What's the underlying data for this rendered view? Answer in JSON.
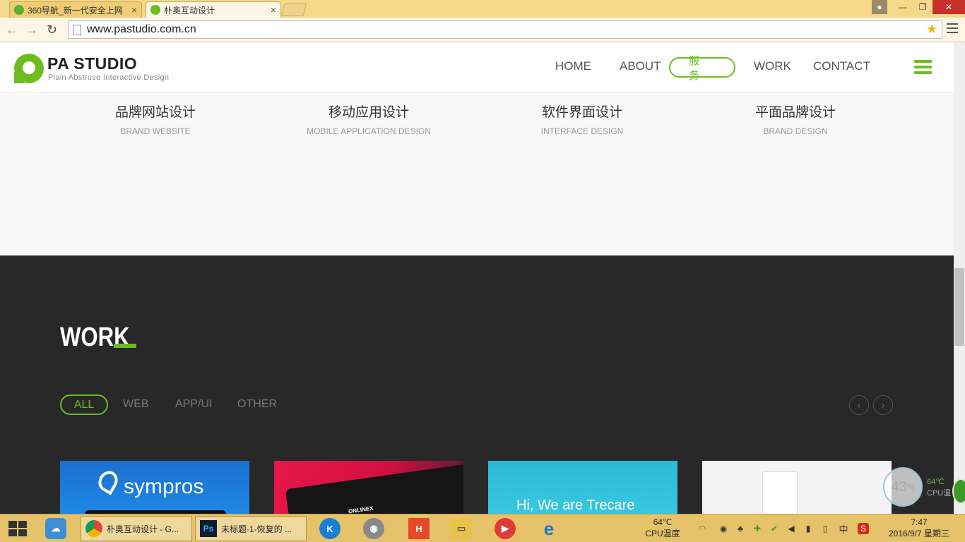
{
  "browser": {
    "tabs": [
      {
        "title": "360导航_新一代安全上网",
        "close": "×"
      },
      {
        "title": "朴奥互动设计",
        "close": "×"
      }
    ],
    "url": "www.pastudio.com.cn",
    "window_buttons": {
      "minimize": "—",
      "restore": "❐",
      "close": "✕"
    }
  },
  "site": {
    "logo": {
      "title": "PA STUDIO",
      "subtitle": "Plain Abstruse Interactive Design"
    },
    "nav": [
      "HOME",
      "ABOUT",
      "服 务",
      "WORK",
      "CONTACT"
    ],
    "active_nav": "服 务",
    "services": [
      {
        "cn": "品牌网站设计",
        "en": "BRAND WEBSITE"
      },
      {
        "cn": "移动应用设计",
        "en": "MOBILE APPLICATION DESIGN"
      },
      {
        "cn": "软件界面设计",
        "en": "INTERFACE DESIGN"
      },
      {
        "cn": "平面品牌设计",
        "en": "BRAND DESIGN"
      }
    ],
    "work": {
      "title": "WORK",
      "filters": [
        "ALL",
        "WEB",
        "APP/UI",
        "OTHER"
      ],
      "active_filter": "ALL",
      "prev": "‹",
      "next": "›",
      "thumbnails": [
        {
          "text": "sympros"
        },
        {
          "text": "ONLINEX"
        },
        {
          "text": "Hi, We are Trecare"
        },
        {
          "text": ""
        }
      ]
    },
    "accent_color": "#6dbd1f"
  },
  "cpu_widget": {
    "percent": "43",
    "unit": "%",
    "temp": "64℃",
    "label": "CPU温"
  },
  "taskbar": {
    "apps": [
      {
        "label": "朴奥互动设计 - G...",
        "icon": "chrome-icon"
      },
      {
        "label": "未标题-1-恢复的 ...",
        "icon": "photoshop-icon"
      }
    ],
    "cpu_temp": "64℃",
    "cpu_label": "CPU温度",
    "ime": "中",
    "time": "7:47",
    "date": "2016/9/7 星期三"
  }
}
